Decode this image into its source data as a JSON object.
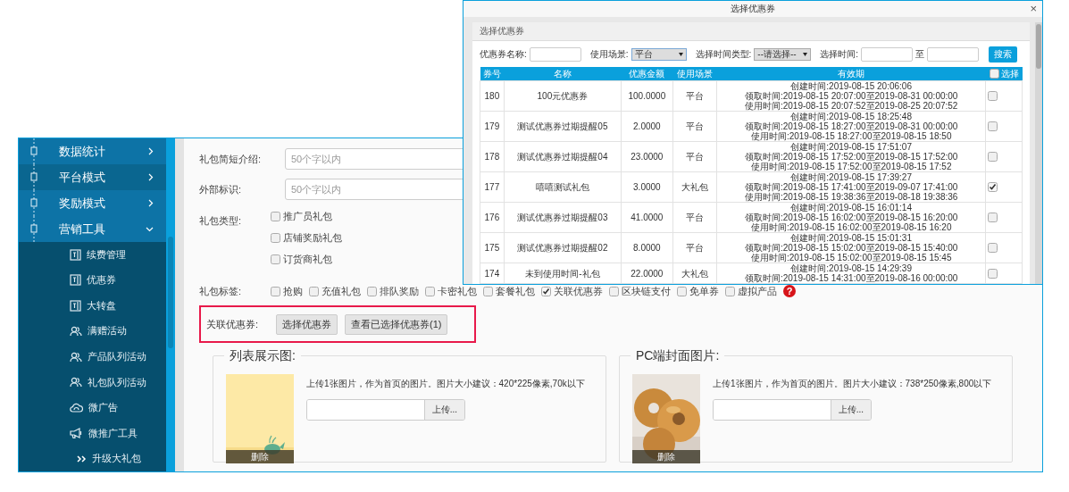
{
  "sidebar": {
    "items": [
      {
        "label": "数据统计",
        "expanded": false,
        "highlighted": false
      },
      {
        "label": "平台模式",
        "expanded": false,
        "highlighted": true
      },
      {
        "label": "奖励模式",
        "expanded": false,
        "highlighted": false
      },
      {
        "label": "营销工具",
        "expanded": true,
        "highlighted": false,
        "children": [
          {
            "label": "续费管理"
          },
          {
            "label": "优惠券"
          },
          {
            "label": "大转盘"
          },
          {
            "label": "满赠活动"
          },
          {
            "label": "产品队列活动"
          },
          {
            "label": "礼包队列活动"
          },
          {
            "label": "微广告"
          },
          {
            "label": "微推广工具",
            "children": [
              {
                "label": "升级大礼包"
              }
            ]
          }
        ]
      }
    ]
  },
  "form": {
    "fields": [
      {
        "label": "礼包简短介绍:",
        "placeholder": "50个字以内"
      },
      {
        "label": "外部标识:",
        "placeholder": "50个字以内"
      }
    ],
    "gift_type": {
      "label": "礼包类型:",
      "options": [
        {
          "label": "推广员礼包",
          "checked": false
        },
        {
          "label": "店铺奖励礼包",
          "checked": false
        },
        {
          "label": "订货商礼包",
          "checked": false
        }
      ]
    },
    "tags": {
      "label": "礼包标签:",
      "help": "?",
      "options": [
        {
          "label": "抢购",
          "checked": false
        },
        {
          "label": "充值礼包",
          "checked": false
        },
        {
          "label": "排队奖励",
          "checked": false
        },
        {
          "label": "卡密礼包",
          "checked": false
        },
        {
          "label": "套餐礼包",
          "checked": false
        },
        {
          "label": "关联优惠券",
          "checked": true
        },
        {
          "label": "区块链支付",
          "checked": false
        },
        {
          "label": "免单券",
          "checked": false
        },
        {
          "label": "虚拟产品",
          "checked": false
        }
      ]
    },
    "coupon_link": {
      "label": "关联优惠券:",
      "buttons": [
        "选择优惠券",
        "查看已选择优惠券(1)"
      ]
    },
    "uploads": [
      {
        "title": "列表展示图:",
        "hint": "上传1张图片，作为首页的图片。图片大小建议：420*225像素,70k以下",
        "button": "上传...",
        "delete": "删除",
        "kind": "whale"
      },
      {
        "title": "PC端封面图片:",
        "hint": "上传1张图片，作为首页的图片。图片大小建议：738*250像素,800以下",
        "button": "上传...",
        "delete": "删除",
        "kind": "donut"
      }
    ]
  },
  "dialog": {
    "title": "选择优惠券",
    "close": "×",
    "panel_title": "选择优惠券",
    "filters": {
      "name_label": "优惠券名称:",
      "scene_label": "使用场景:",
      "scene_value": "平台",
      "time_type_label": "选择时间类型:",
      "time_type_value": "--请选择--",
      "time_label": "选择时间:",
      "to": "至",
      "search": "搜索"
    },
    "table": {
      "columns": [
        "券号",
        "名称",
        "优惠金额",
        "使用场景",
        "有效期",
        "选择"
      ],
      "header_checked": false,
      "rows": [
        {
          "id": "180",
          "name": "100元优惠券",
          "amount": "100.0000",
          "scene": "平台",
          "validity": [
            "创建时间:2019-08-15 20:06:06",
            "领取时间:2019-08-15 20:07:00至2019-08-31 00:00:00",
            "使用时间:2019-08-15 20:07:52至2019-08-25 20:07:52"
          ],
          "selected": false
        },
        {
          "id": "179",
          "name": "测试优惠券过期提醒05",
          "amount": "2.0000",
          "scene": "平台",
          "validity": [
            "创建时间:2019-08-15 18:25:48",
            "领取时间:2019-08-15 18:27:00至2019-08-31 00:00:00",
            "使用时间:2019-08-15 18:27:00至2019-08-15 18:50"
          ],
          "selected": false
        },
        {
          "id": "178",
          "name": "测试优惠券过期提醒04",
          "amount": "23.0000",
          "scene": "平台",
          "validity": [
            "创建时间:2019-08-15 17:51:07",
            "领取时间:2019-08-15 17:52:00至2019-08-15 17:52:00",
            "使用时间:2019-08-15 17:52:00至2019-08-15 17:52"
          ],
          "selected": false
        },
        {
          "id": "177",
          "name": "嘻嘻测试礼包",
          "amount": "3.0000",
          "scene": "大礼包",
          "validity": [
            "创建时间:2019-08-15 17:39:27",
            "领取时间:2019-08-15 17:41:00至2019-09-07 17:41:00",
            "使用时间:2019-08-15 19:38:36至2019-08-18 19:38:36"
          ],
          "selected": true
        },
        {
          "id": "176",
          "name": "测试优惠券过期提醒03",
          "amount": "41.0000",
          "scene": "平台",
          "validity": [
            "创建时间:2019-08-15 16:01:14",
            "领取时间:2019-08-15 16:02:00至2019-08-15 16:20:00",
            "使用时间:2019-08-15 16:02:00至2019-08-15 16:20"
          ],
          "selected": false
        },
        {
          "id": "175",
          "name": "测试优惠券过期提醒02",
          "amount": "8.0000",
          "scene": "平台",
          "validity": [
            "创建时间:2019-08-15 15:01:31",
            "领取时间:2019-08-15 15:02:00至2019-08-15 15:40:00",
            "使用时间:2019-08-15 15:02:00至2019-08-15 15:45"
          ],
          "selected": false
        },
        {
          "id": "174",
          "name": "未到使用时间-礼包",
          "amount": "22.0000",
          "scene": "大礼包",
          "validity": [
            "创建时间:2019-08-15 14:29:39",
            "领取时间:2019-08-15 14:31:00至2019-08-16 00:00:00"
          ],
          "selected": false
        }
      ]
    }
  }
}
